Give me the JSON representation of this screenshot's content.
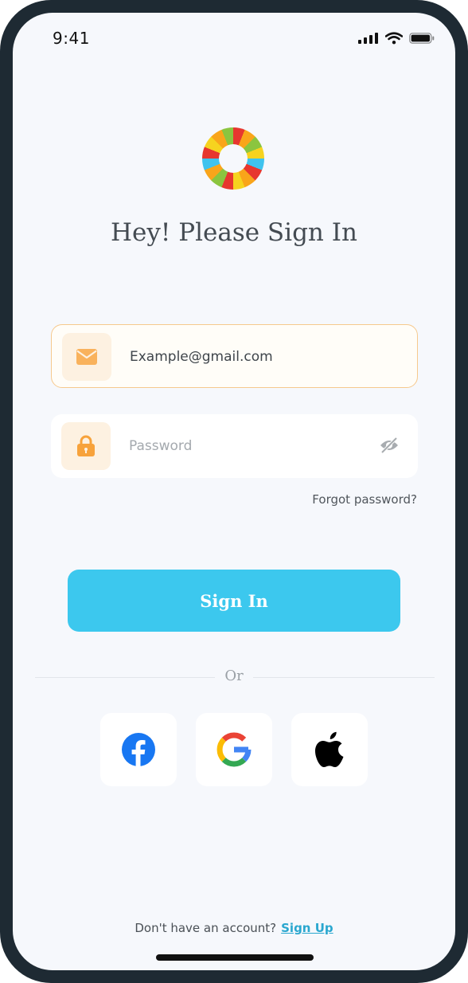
{
  "status_bar": {
    "time": "9:41"
  },
  "title": "Hey! Please Sign In",
  "email_field": {
    "value": "Example@gmail.com",
    "icon": "mail-icon"
  },
  "password_field": {
    "placeholder": "Password",
    "icon": "lock-icon",
    "toggle_icon": "eye-off-icon"
  },
  "forgot_password": "Forgot password?",
  "sign_in_button": "Sign In",
  "divider_text": "Or",
  "social_buttons": [
    {
      "provider": "facebook",
      "icon": "facebook-icon"
    },
    {
      "provider": "google",
      "icon": "google-icon"
    },
    {
      "provider": "apple",
      "icon": "apple-icon"
    }
  ],
  "footer": {
    "prompt": "Don't have an account?",
    "link": "Sign Up"
  },
  "colors": {
    "accent": "#3cc8ee",
    "icon_orange": "#f7a23b",
    "link": "#2aa7cf"
  }
}
